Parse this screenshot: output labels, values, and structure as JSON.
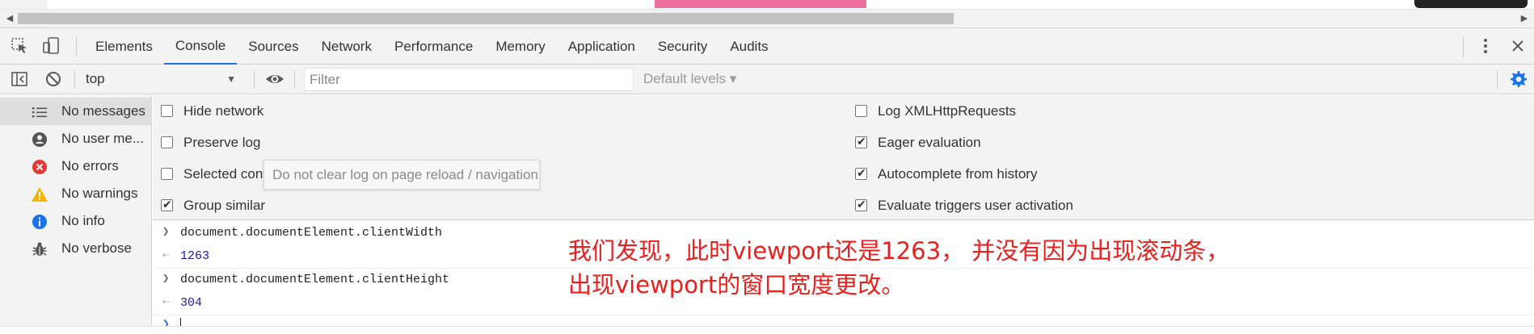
{
  "tabs": [
    "Elements",
    "Console",
    "Sources",
    "Network",
    "Performance",
    "Memory",
    "Application",
    "Security",
    "Audits"
  ],
  "active_tab": "Console",
  "toolbar": {
    "context": "top",
    "filter_placeholder": "Filter",
    "levels": "Default levels ▾"
  },
  "sidebar": {
    "items": [
      {
        "label": "No messages",
        "icon": "list-icon"
      },
      {
        "label": "No user me...",
        "icon": "user-icon"
      },
      {
        "label": "No errors",
        "icon": "error-icon",
        "color": "#e53935"
      },
      {
        "label": "No warnings",
        "icon": "warning-icon",
        "color": "#f4b400"
      },
      {
        "label": "No info",
        "icon": "info-icon",
        "color": "#1a73e8"
      },
      {
        "label": "No verbose",
        "icon": "bug-icon"
      }
    ]
  },
  "settings": {
    "left": [
      {
        "label": "Hide network",
        "checked": false
      },
      {
        "label": "Preserve log",
        "checked": false
      },
      {
        "label": "Selected context only",
        "checked": false
      },
      {
        "label": "Group similar",
        "checked": true
      }
    ],
    "right": [
      {
        "label": "Log XMLHttpRequests",
        "checked": false
      },
      {
        "label": "Eager evaluation",
        "checked": true
      },
      {
        "label": "Autocomplete from history",
        "checked": true
      },
      {
        "label": "Evaluate triggers user activation",
        "checked": true
      }
    ],
    "tooltip": "Do not clear log on page reload / navigation"
  },
  "console": {
    "messages": [
      {
        "type": "input",
        "text": "document.documentElement.clientWidth"
      },
      {
        "type": "result",
        "text": "1263"
      },
      {
        "type": "input",
        "text": "document.documentElement.clientHeight"
      },
      {
        "type": "result",
        "text": "304"
      }
    ]
  },
  "annotation": {
    "line1": "我们发现，此时viewport还是1263， 并没有因为出现滚动条，",
    "line2": "出现viewport的窗口宽度更改。",
    "color": "#e8201e"
  },
  "colors": {
    "accent": "#1a73e8",
    "error": "#e53935",
    "warning": "#f4b400",
    "pink": "#ec6f9e"
  }
}
